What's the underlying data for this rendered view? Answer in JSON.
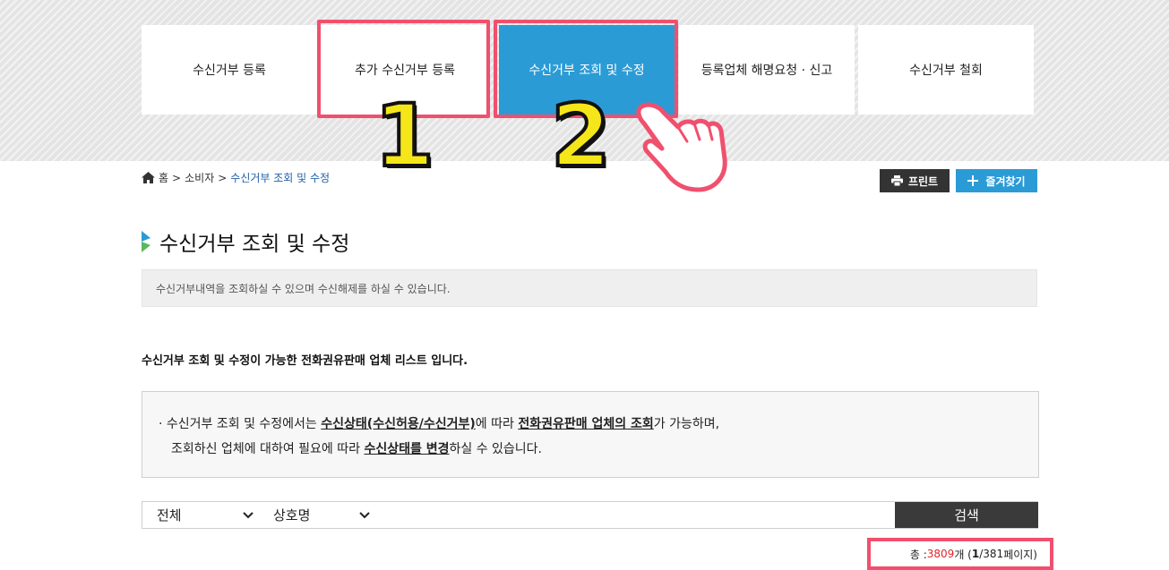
{
  "tabs": [
    {
      "label": "수신거부 등록"
    },
    {
      "label": "추가 수신거부 등록"
    },
    {
      "label": "수신거부 조회 및 수정"
    },
    {
      "label": "등록업체 해명요청 · 신고"
    },
    {
      "label": "수신거부 철회"
    }
  ],
  "annotations": {
    "num1": "1",
    "num2": "2"
  },
  "breadcrumb": {
    "home": "홈",
    "level1": "소비자",
    "current": "수신거부 조회 및 수정",
    "sep": ">"
  },
  "buttons": {
    "print": "프린트",
    "favorite": "즐겨찾기",
    "search": "검색"
  },
  "page": {
    "title": "수신거부 조회 및 수정",
    "intro": "수신거부내역을 조회하실 수 있으며 수신해제를 하실 수 있습니다.",
    "subhead": "수신거부 조회 및 수정이 가능한 전화권유판매 업체 리스트 입니다."
  },
  "info": {
    "bullet": "·",
    "l1_a": "수신거부 조회 및 수정에서는 ",
    "l1_b": "수신상태(수신허용/수신거부)",
    "l1_c": "에 따라 ",
    "l1_d": "전화권유판매 업체의 조회",
    "l1_e": "가 가능하며,",
    "l2_a": "조회하신 업체에 대하여 필요에 따라 ",
    "l2_b": "수신상태를 변경",
    "l2_c": "하실 수 있습니다."
  },
  "search": {
    "filter1": "전체",
    "filter2": "상호명",
    "value": ""
  },
  "total": {
    "prefix": "총 : ",
    "count": "3809",
    "unit": " 개 (",
    "page_current": "1",
    "page_sep": " / ",
    "page_total": "381",
    "page_suffix": " 페이지)"
  },
  "colors": {
    "active_tab": "#2b9bd6",
    "callout": "#f0506e",
    "count": "#e0242a",
    "annotation": "#f5e61a"
  }
}
